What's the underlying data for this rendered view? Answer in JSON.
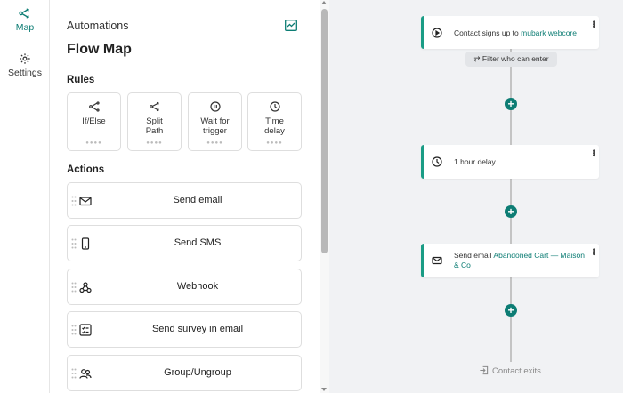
{
  "rail": {
    "items": [
      {
        "label": "Map",
        "icon": "split-icon",
        "active": true
      },
      {
        "label": "Settings",
        "icon": "gear-icon",
        "active": false
      }
    ]
  },
  "panel": {
    "header": "Automations",
    "title": "Flow Map",
    "rules_label": "Rules",
    "rules": [
      {
        "label": "If/Else",
        "icon": "branch-icon"
      },
      {
        "label": "Split\nPath",
        "icon": "split-path-icon"
      },
      {
        "label": "Wait for\ntrigger",
        "icon": "pause-icon"
      },
      {
        "label": "Time\ndelay",
        "icon": "clock-icon"
      }
    ],
    "actions_label": "Actions",
    "actions": [
      {
        "label": "Send email",
        "icon": "envelope-icon"
      },
      {
        "label": "Send SMS",
        "icon": "phone-icon"
      },
      {
        "label": "Webhook",
        "icon": "webhook-icon"
      },
      {
        "label": "Send survey in email",
        "icon": "survey-icon"
      },
      {
        "label": "Group/Ungroup",
        "icon": "group-icon"
      }
    ]
  },
  "flow": {
    "trigger": {
      "prefix": "Contact signs up to ",
      "highlight": "mubark webcore"
    },
    "filter": "Filter who can enter",
    "delay": {
      "text": "1 hour delay"
    },
    "email": {
      "prefix": "Send email ",
      "highlight": "Abandoned Cart — Maison & Co"
    },
    "exit": "Contact exits",
    "accent": "#0d7d74"
  }
}
